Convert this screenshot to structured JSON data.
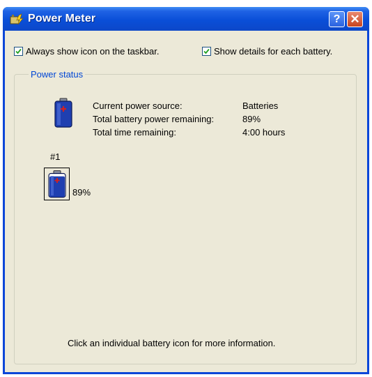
{
  "window": {
    "title": "Power Meter",
    "help_label": "?",
    "close_label": "✕"
  },
  "options": {
    "always_show_icon": {
      "label": "Always show icon on the taskbar.",
      "checked": true
    },
    "show_details": {
      "label": "Show details for each battery.",
      "checked": true
    }
  },
  "power_status": {
    "group_label": "Power status",
    "rows": [
      {
        "label": "Current power source:",
        "value": "Batteries"
      },
      {
        "label": "Total battery power remaining:",
        "value": "89%"
      },
      {
        "label": "Total time remaining:",
        "value": "4:00 hours"
      }
    ],
    "batteries": [
      {
        "number": "#1",
        "percent": "89%",
        "level": 0.89
      }
    ]
  },
  "footer": {
    "hint": "Click an individual battery icon for more information."
  },
  "icons": [
    "power-meter-icon",
    "help-icon",
    "close-icon",
    "checkmark-icon",
    "battery-icon"
  ],
  "colors": {
    "title_bar": "#0a4fd8",
    "client_bg": "#ece9d8",
    "group_label": "#0046d5",
    "close_button": "#c8441f",
    "battery_blue": "#1f3fb0",
    "battery_plus": "#d22020"
  }
}
